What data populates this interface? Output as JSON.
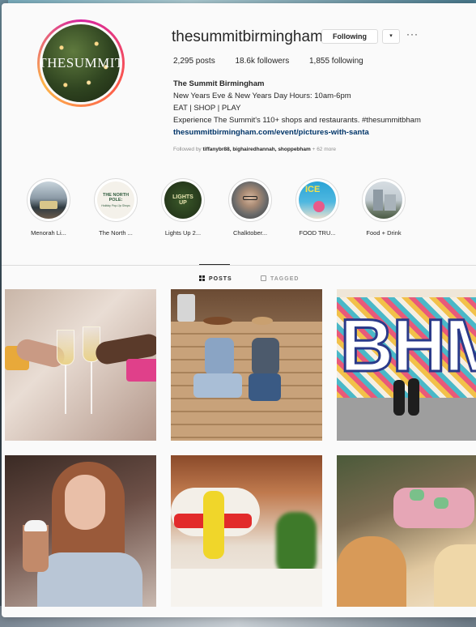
{
  "profile": {
    "username": "thesummitbirmingham",
    "avatar_text": "THESUMMIT",
    "following_label": "Following",
    "dropdown_icon": "▾",
    "more_icon": "···",
    "stats": {
      "posts": "2,295 posts",
      "followers": "18.6k followers",
      "following": "1,855 following"
    },
    "bio": {
      "name": "The Summit Birmingham",
      "line1": "New Years Eve & New Years Day Hours: 10am-6pm",
      "line2": "EAT | SHOP | PLAY",
      "line3": "Experience The Summit's 110+ shops and restaurants. #thesummitbham",
      "link": "thesummitbirmingham.com/event/pictures-with-santa"
    },
    "followed_by": {
      "prefix": "Followed by ",
      "names": "tiffanybr88, bighairedhannah, shoppebham",
      "suffix": " + 62 more"
    }
  },
  "highlights": [
    {
      "label": "Menorah Li..."
    },
    {
      "label": "The North ..."
    },
    {
      "label": "Lights Up 2..."
    },
    {
      "label": "Chalktober..."
    },
    {
      "label": "FOOD TRU..."
    },
    {
      "label": "Food + Drink"
    }
  ],
  "highlight_art": {
    "north_pole_title": "THE NORTH POLE:",
    "north_pole_sub": "Holiday Pop-Up Shops",
    "lights_up": "LIGHTS UP",
    "ice": "ICE"
  },
  "tabs": {
    "posts": "POSTS",
    "tagged": "TAGGED"
  },
  "grid_art": {
    "bhm": "BHM"
  },
  "colors": {
    "link": "#003569",
    "text": "#262626",
    "muted": "#8e8e8e",
    "border": "#dbdbdb"
  }
}
